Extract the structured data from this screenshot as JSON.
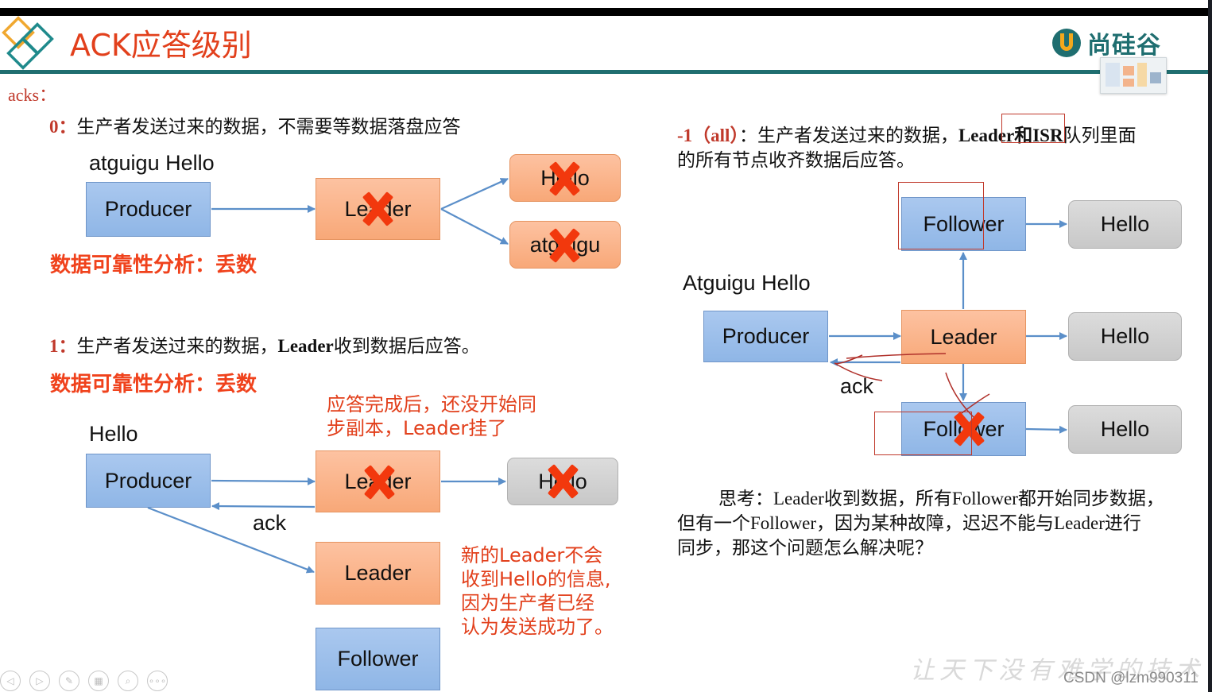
{
  "header": {
    "title": "ACK应答级别",
    "brand": "尚硅谷",
    "logo_icon": "diamond-logo-icon",
    "brand_icon": "u-shield-logo-icon"
  },
  "acks_label": "acks：",
  "level0": {
    "num": "0：",
    "text": "生产者发送过来的数据，不需要等数据落盘应答",
    "messages_label": "atguigu  Hello",
    "producer": "Producer",
    "leader": "Leader",
    "replica1": "Hello",
    "replica2": "atguigu",
    "analysis": "数据可靠性分析：丢数"
  },
  "level1": {
    "num": "1：",
    "text_before": "生产者发送过来的数据，",
    "text_bold": "Leader",
    "text_after": "收到数据后应答。",
    "analysis": "数据可靠性分析：丢数",
    "note1_line1": "应答完成后，还没开始同",
    "note1_line2": "步副本，Leader挂了",
    "message_label": "Hello",
    "producer": "Producer",
    "leader": "Leader",
    "replica": "Hello",
    "ack": "ack",
    "new_leader": "Leader",
    "follower": "Follower",
    "note2": [
      "新的Leader不会",
      "收到Hello的信息,",
      "因为生产者已经",
      "认为发送成功了。"
    ]
  },
  "levelAll": {
    "num": "-1（all）",
    "text_colon": "：生产者发送过来的数据，",
    "text_bold1": "Leader",
    "text_bold2": "和ISR",
    "text_after": "队列里面",
    "text_line2": "的所有节点收齐数据后应答。",
    "messages_label": "Atguigu Hello",
    "producer": "Producer",
    "leader": "Leader",
    "follower_top": "Follower",
    "follower_bottom": "Follower",
    "hello_top": "Hello",
    "hello_mid": "Hello",
    "hello_bottom": "Hello",
    "ack": "ack"
  },
  "think": {
    "line1": "思考：Leader收到数据，所有Follower都开始同步数据，",
    "line2": "但有一个Follower，因为某种故障，迟迟不能与Leader进行",
    "line3": "同步，那这个问题怎么解决呢？"
  },
  "footer": {
    "nav_buttons": [
      {
        "name": "prev-slide-button",
        "glyph": "◁"
      },
      {
        "name": "next-slide-button",
        "glyph": "▷"
      },
      {
        "name": "pen-tool-button",
        "glyph": "✎"
      },
      {
        "name": "slides-overview-button",
        "glyph": "▦"
      },
      {
        "name": "zoom-button",
        "glyph": "⌕"
      },
      {
        "name": "more-options-button",
        "glyph": "∘∘∘"
      }
    ],
    "slogan": "让天下没有难学的技术",
    "watermark": "CSDN @lzm990311"
  },
  "colors": {
    "title_red": "#e2401c",
    "teal": "#1f6e70",
    "producer_blue": "#8fb6e6",
    "leader_orange": "#f8a878",
    "hello_gray": "#c8c8c8",
    "arrow_blue": "#5b8fc9",
    "cross_red": "#f2380d"
  }
}
